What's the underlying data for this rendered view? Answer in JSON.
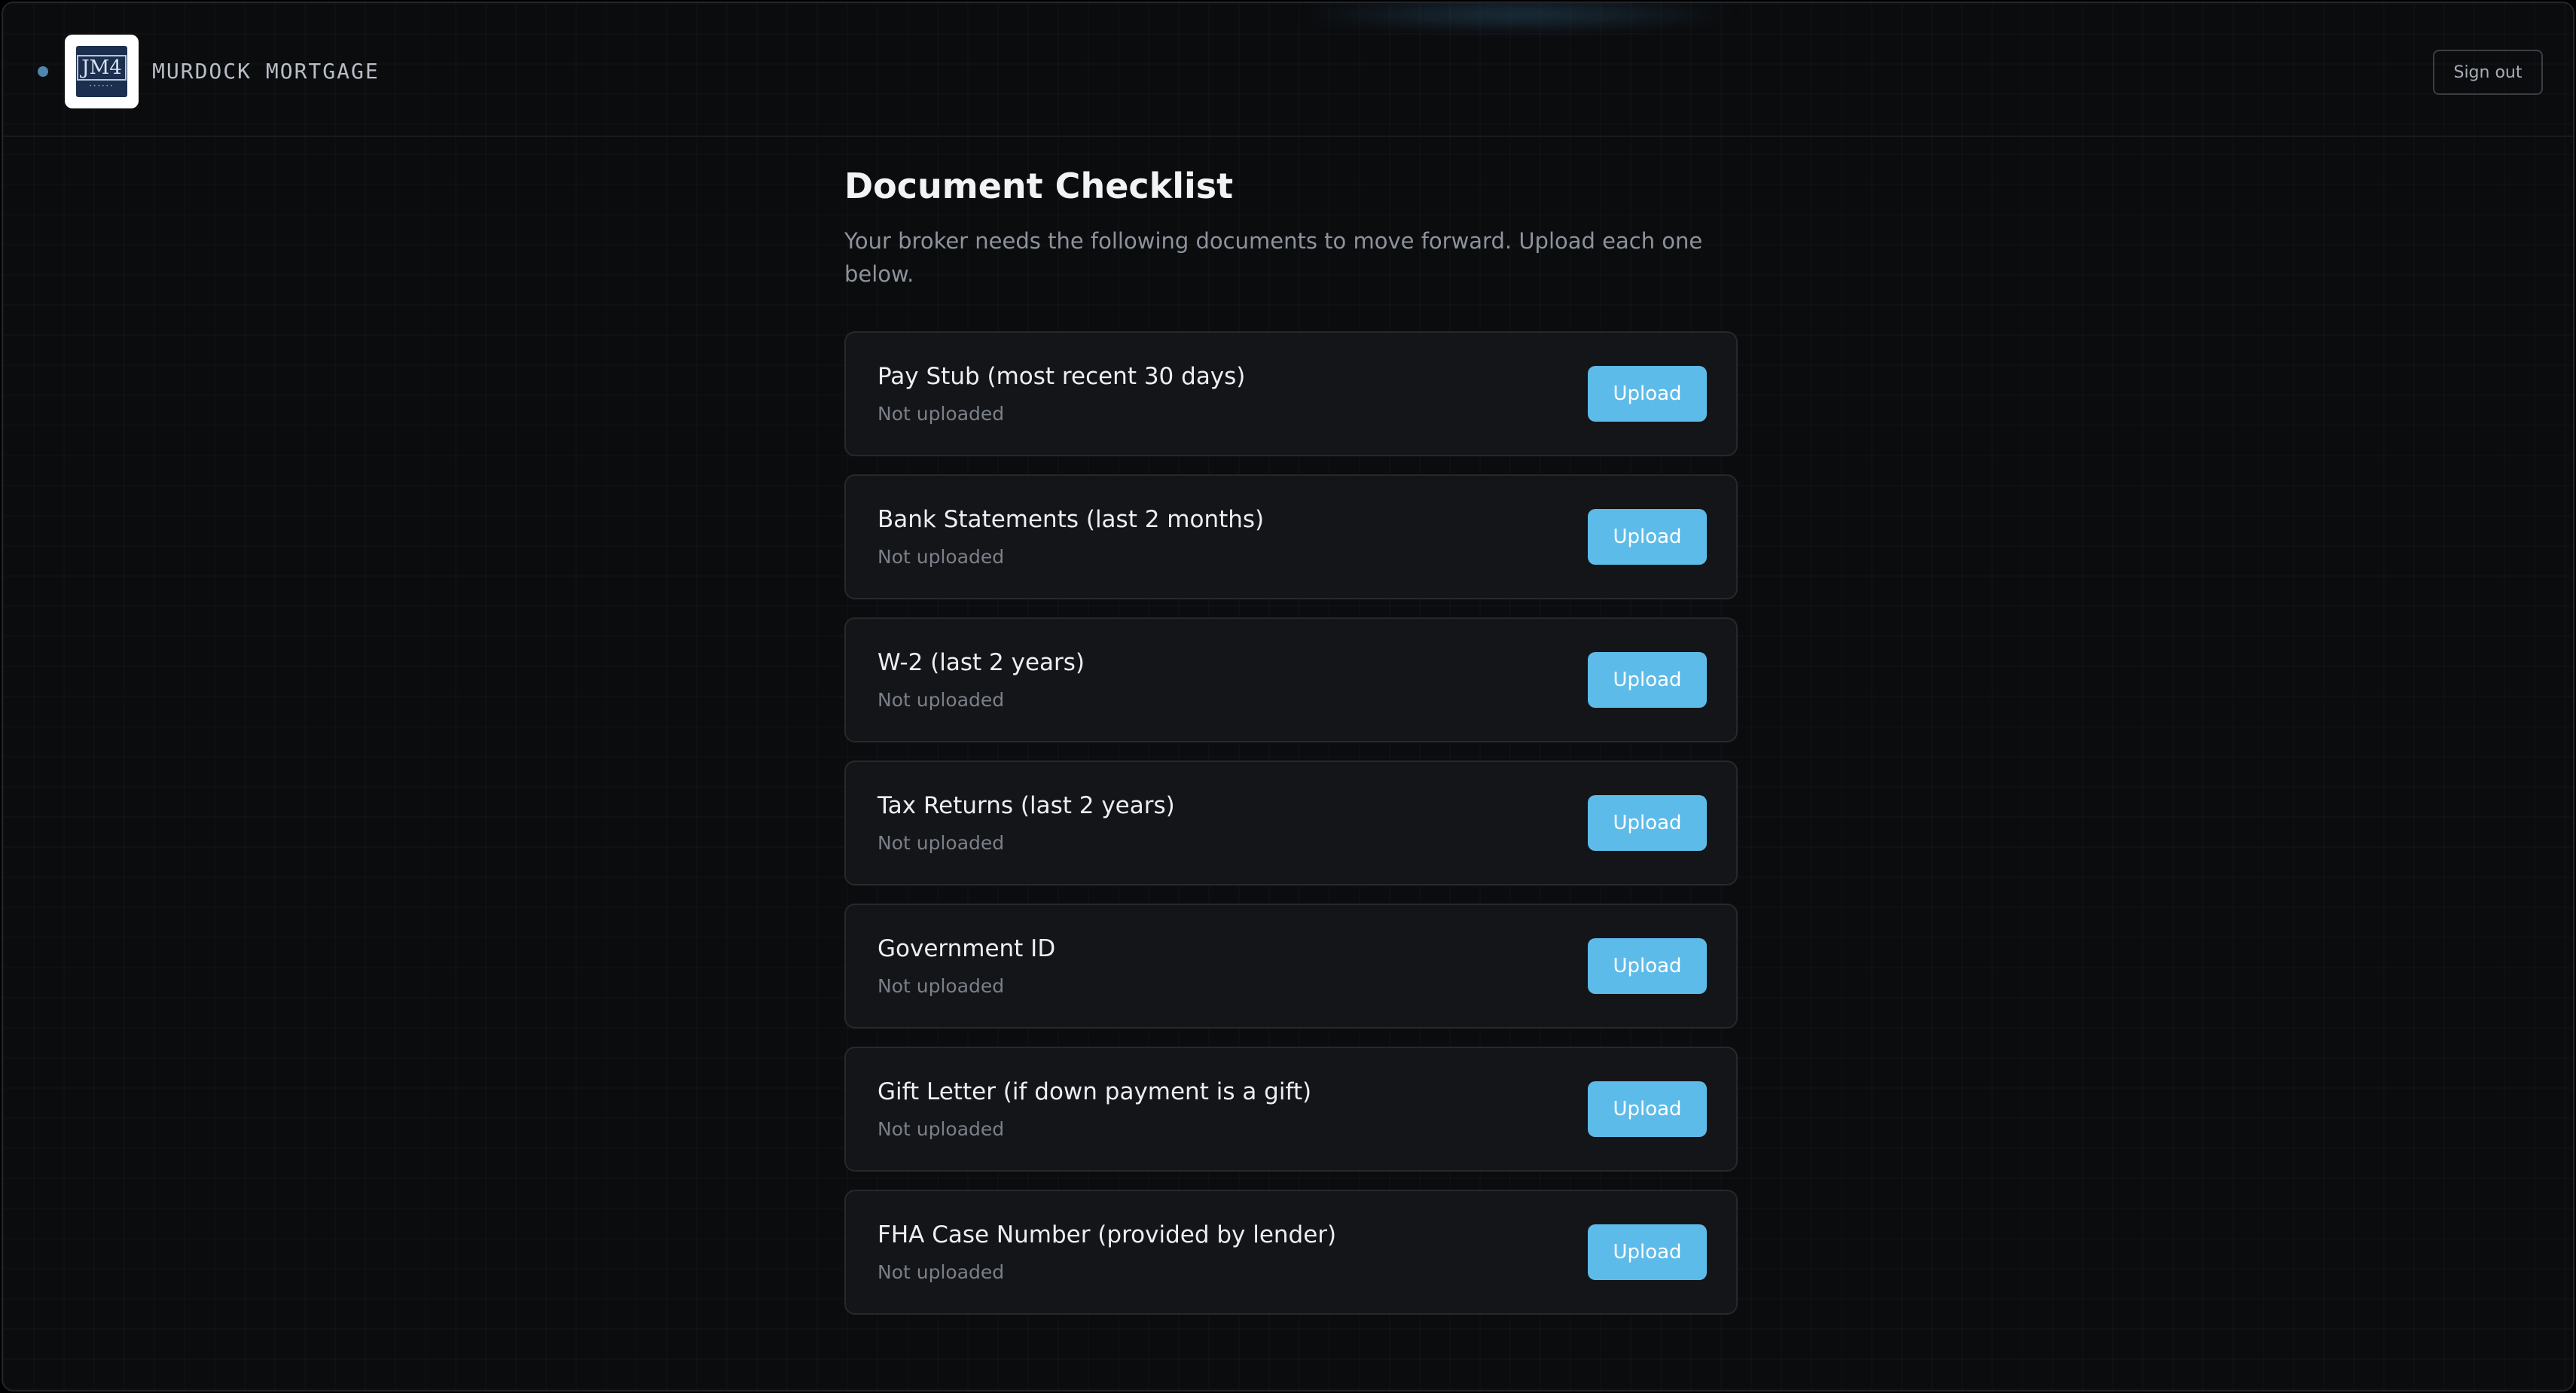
{
  "header": {
    "logo_mark": "JM4",
    "brand": "MURDOCK MORTGAGE",
    "signout_label": "Sign out"
  },
  "main": {
    "title": "Document Checklist",
    "subtitle": "Your broker needs the following documents to move forward. Upload each one below.",
    "documents": [
      {
        "title": "Pay Stub (most recent 30 days)",
        "status": "Not uploaded",
        "action": "Upload"
      },
      {
        "title": "Bank Statements (last 2 months)",
        "status": "Not uploaded",
        "action": "Upload"
      },
      {
        "title": "W-2 (last 2 years)",
        "status": "Not uploaded",
        "action": "Upload"
      },
      {
        "title": "Tax Returns (last 2 years)",
        "status": "Not uploaded",
        "action": "Upload"
      },
      {
        "title": "Government ID",
        "status": "Not uploaded",
        "action": "Upload"
      },
      {
        "title": "Gift Letter (if down payment is a gift)",
        "status": "Not uploaded",
        "action": "Upload"
      },
      {
        "title": "FHA Case Number (provided by lender)",
        "status": "Not uploaded",
        "action": "Upload"
      }
    ]
  },
  "colors": {
    "background": "#0b0c0e",
    "card": "#141518",
    "accent": "#5dbbe9",
    "status_dot": "#4f86ad"
  }
}
